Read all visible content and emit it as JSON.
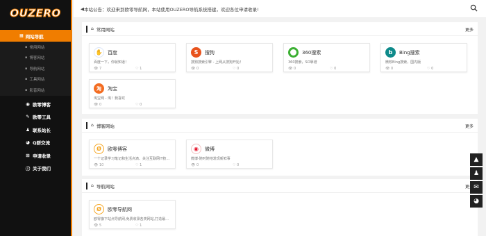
{
  "logo": "OUZERO",
  "sidebar": {
    "main": {
      "label": "网站导航",
      "icon": "sitemap-icon"
    },
    "sub": [
      "常用网站",
      "博客网站",
      "导航网站",
      "工具网站",
      "影音网站"
    ],
    "items": [
      {
        "label": "欧零博客",
        "icon": "dot-icon"
      },
      {
        "label": "欧零工具",
        "icon": "wrench-icon"
      },
      {
        "label": "联系站长",
        "icon": "qq-icon"
      },
      {
        "label": "Q群交流",
        "icon": "chat-icon"
      },
      {
        "label": "申请收录",
        "icon": "plus-square-icon"
      },
      {
        "label": "关于我们",
        "icon": "info-icon"
      }
    ]
  },
  "topbar": {
    "notice": "本站公告：欢迎来到欧零导航网，本站使用OUZERO导航系统搭建，欢迎各位申请收录!"
  },
  "sections": [
    {
      "title": "常用网站",
      "more": "更多",
      "cards": [
        {
          "name": "百度",
          "desc": "百度一下，你就知道！",
          "views": "7",
          "likes": "1",
          "color": "#2f6bd7",
          "glyph": "✋"
        },
        {
          "name": "搜狗",
          "desc": "搜狗搜索引擎 - 上网从搜狗开始！",
          "views": "0",
          "likes": "0",
          "color": "#e8531d",
          "glyph": "S"
        },
        {
          "name": "360搜索",
          "desc": "360搜索，SO靠谱",
          "views": "0",
          "likes": "0",
          "color": "#3cb033",
          "glyph": "○"
        },
        {
          "name": "Bing搜索",
          "desc": "微软Bing搜索，国内版",
          "views": "0",
          "likes": "0",
          "color": "#0e8a8a",
          "glyph": "b"
        },
        {
          "name": "淘宝",
          "desc": "淘宝网 - 淘！我喜欢",
          "views": "0",
          "likes": "0",
          "color": "#f36c21",
          "glyph": "淘"
        }
      ]
    },
    {
      "title": "博客网站",
      "more": "更多",
      "cards": [
        {
          "name": "欧零博客",
          "desc": "一个记录学习笔记和生活点滴、关注互联网IT技...",
          "views": "10",
          "likes": "1",
          "color": "#f5a623",
          "glyph": "Ø"
        },
        {
          "name": "微博",
          "desc": "微博-随时随地发现新鲜事",
          "views": "0",
          "likes": "0",
          "color": "#e6162d",
          "glyph": "◉"
        }
      ]
    },
    {
      "title": "导航网站",
      "more": "更多",
      "cards": [
        {
          "name": "欧零导航网",
          "desc": "欧零旗下站点导航网,免费收录各类网站,打造最...",
          "views": "5",
          "likes": "1",
          "color": "#f5a623",
          "glyph": "Ø"
        }
      ]
    }
  ]
}
